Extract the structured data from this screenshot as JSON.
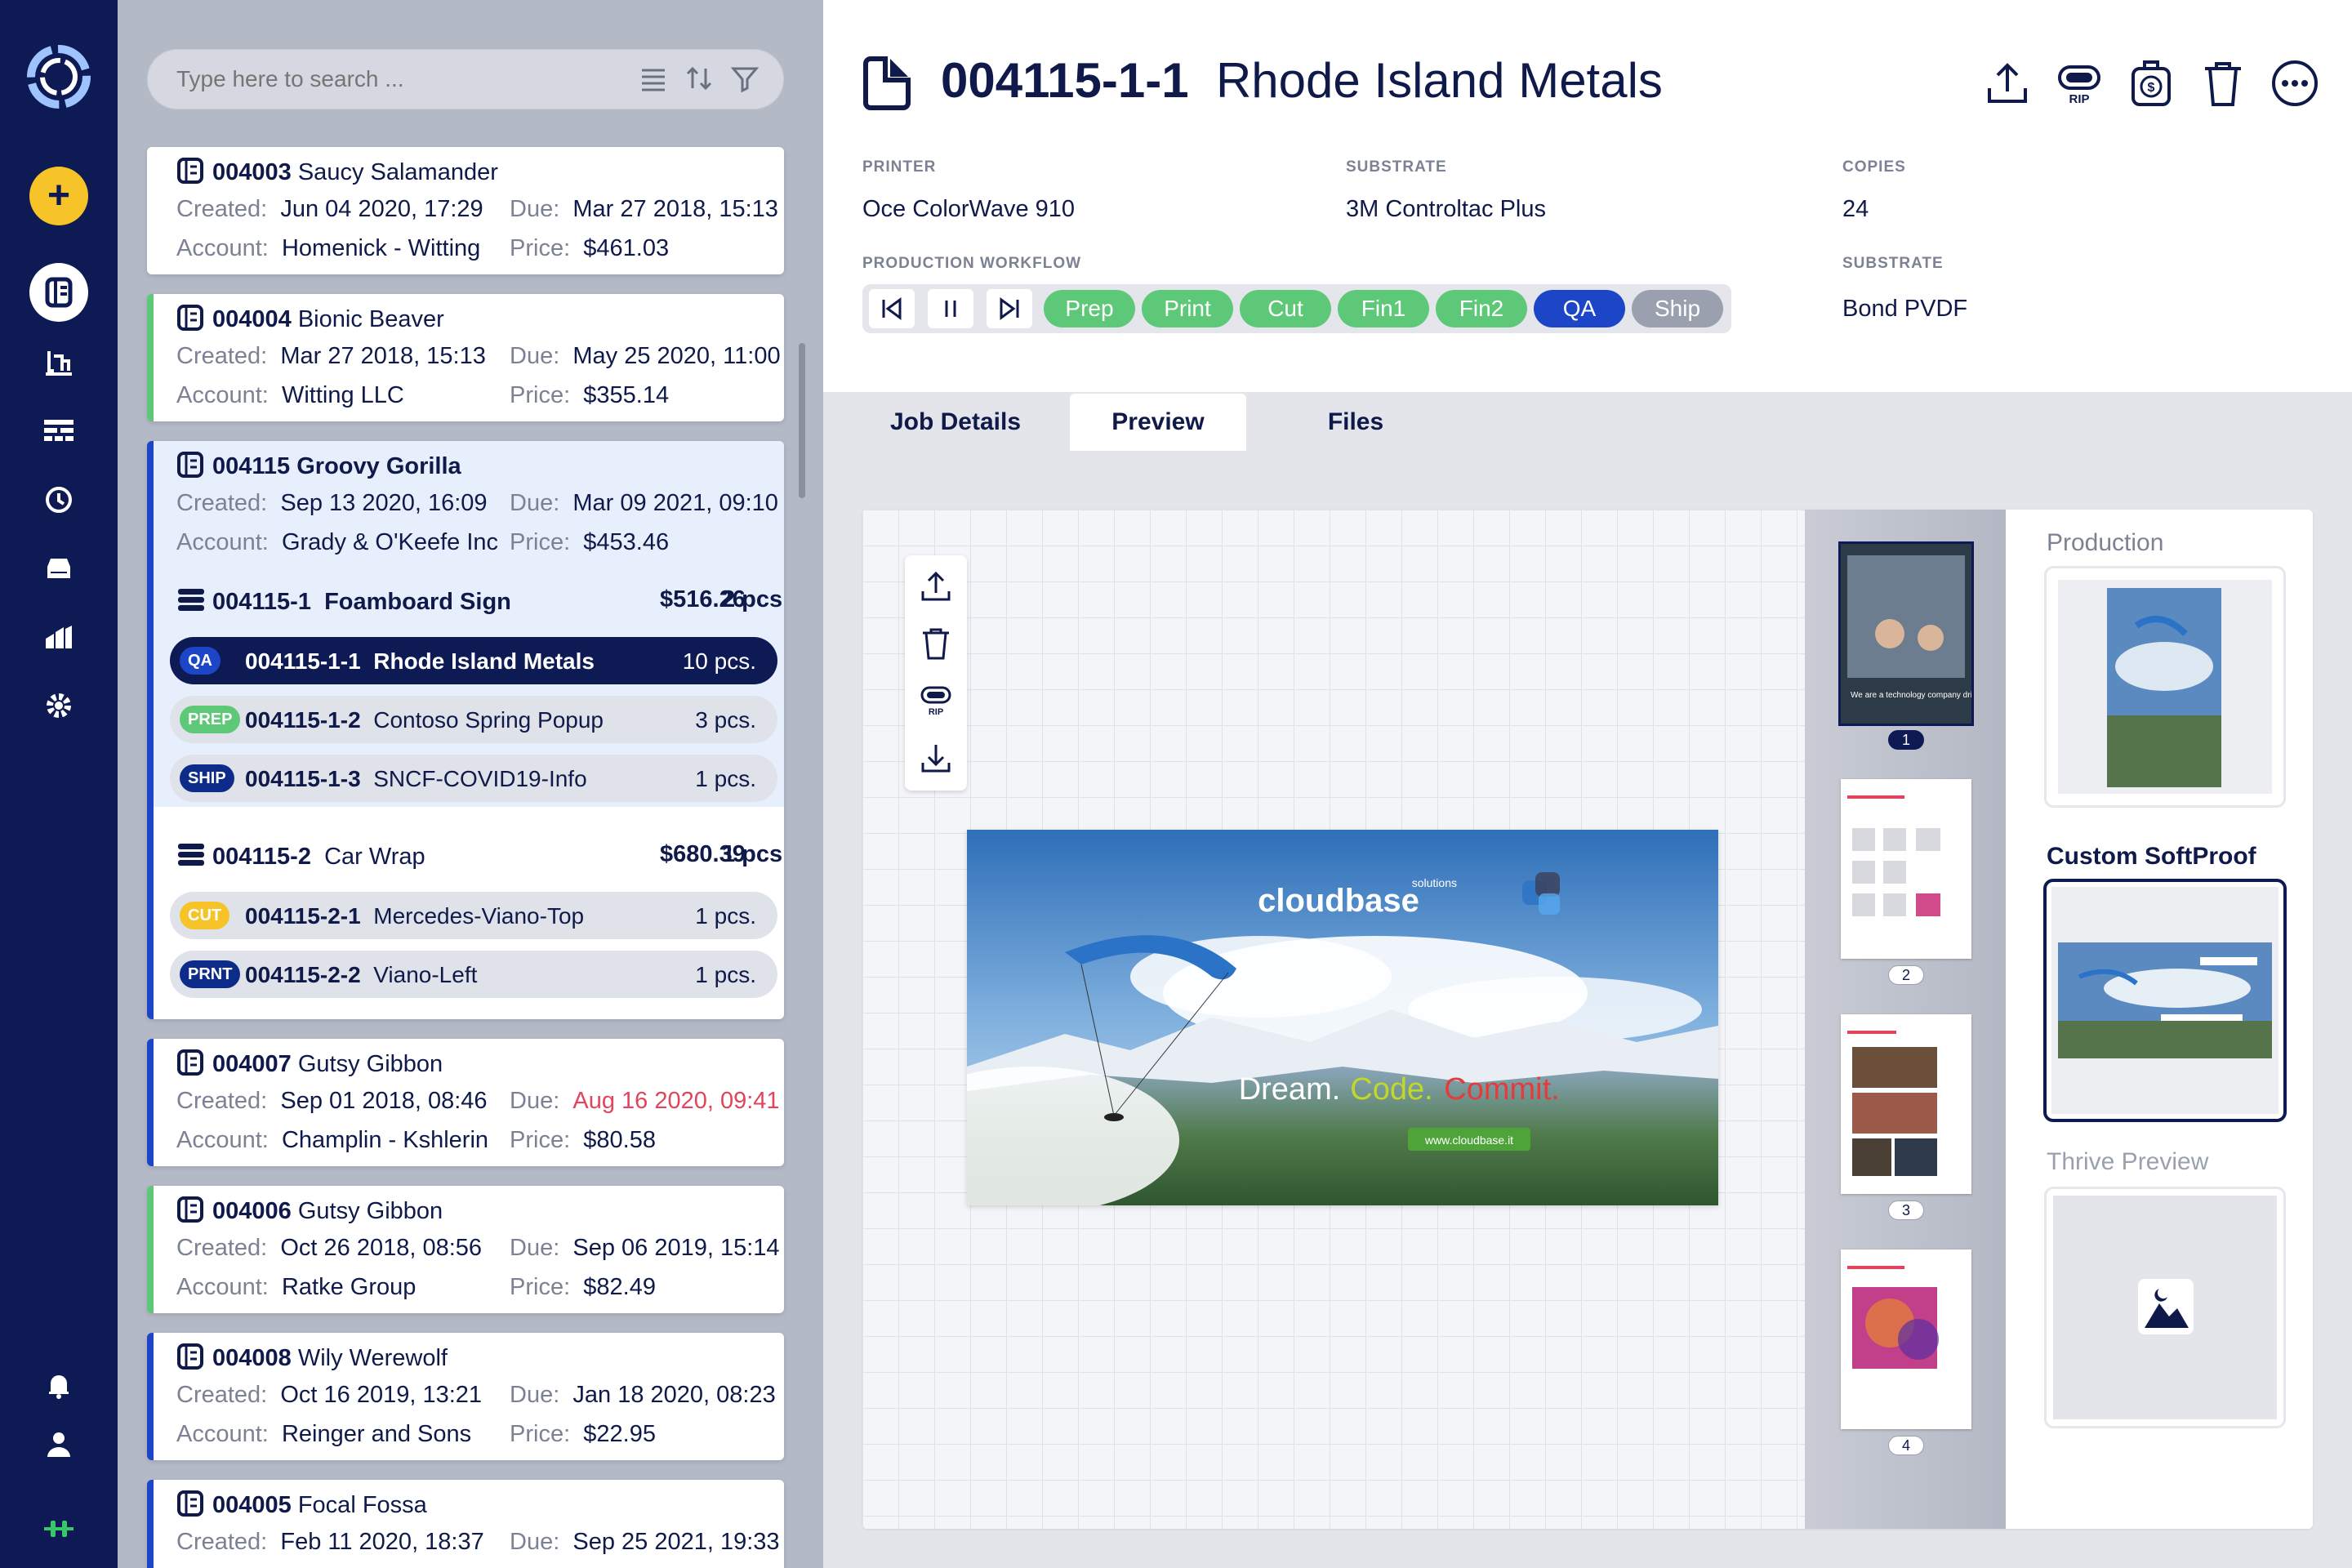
{
  "rail": {
    "items": [
      "sync-logo",
      "add",
      "jobs",
      "printers",
      "dashboard",
      "history",
      "storage",
      "reports",
      "settings",
      "notifications",
      "profile",
      "brand"
    ]
  },
  "search": {
    "placeholder": "Type here to search ..."
  },
  "jobs": [
    {
      "id": "004003",
      "name": "Saucy Salamander",
      "created_label": "Created:",
      "created": "Jun 04 2020, 17:29",
      "due_label": "Due:",
      "due": "Mar 27 2018, 15:13",
      "account_label": "Account:",
      "account": "Homenick - Witting",
      "price_label": "Price:",
      "price": "$461.03"
    },
    {
      "id": "004004",
      "name": "Bionic Beaver",
      "created_label": "Created:",
      "created": "Mar 27 2018, 15:13",
      "due_label": "Due:",
      "due": "May 25 2020, 11:00",
      "account_label": "Account:",
      "account": "Witting LLC",
      "price_label": "Price:",
      "price": "$355.14"
    },
    {
      "id": "004115",
      "name": "Groovy Gorilla",
      "created_label": "Created:",
      "created": "Sep 13 2020, 16:09",
      "due_label": "Due:",
      "due": "Mar 09 2021, 09:10",
      "account_label": "Account:",
      "account": "Grady & O'Keefe Inc",
      "price_label": "Price:",
      "price": "$453.46"
    },
    {
      "id": "004007",
      "name": "Gutsy Gibbon",
      "created_label": "Created:",
      "created": "Sep 01 2018, 08:46",
      "due_label": "Due:",
      "due": "Aug 16 2020, 09:41",
      "account_label": "Account:",
      "account": "Champlin - Kshlerin",
      "price_label": "Price:",
      "price": "$80.58"
    },
    {
      "id": "004006",
      "name": "Gutsy Gibbon",
      "created_label": "Created:",
      "created": "Oct 26 2018, 08:56",
      "due_label": "Due:",
      "due": "Sep 06 2019, 15:14",
      "account_label": "Account:",
      "account": "Ratke Group",
      "price_label": "Price:",
      "price": "$82.49"
    },
    {
      "id": "004008",
      "name": "Wily Werewolf",
      "created_label": "Created:",
      "created": "Oct 16 2019, 13:21",
      "due_label": "Due:",
      "due": "Jan 18 2020, 08:23",
      "account_label": "Account:",
      "account": "Reinger and Sons",
      "price_label": "Price:",
      "price": "$22.95"
    },
    {
      "id": "004005",
      "name": "Focal Fossa",
      "created_label": "Created:",
      "created": "Feb 11 2020, 18:37",
      "due_label": "Due:",
      "due": "Sep 25 2021, 19:33"
    }
  ],
  "subjobs": [
    {
      "id": "004115-1",
      "name": "Foamboard Sign",
      "qty": "2 pcs.",
      "price": "$516.26"
    },
    {
      "id": "004115-2",
      "name": "Car Wrap",
      "qty": "1 pcs.",
      "price": "$680.39"
    }
  ],
  "items": [
    {
      "tag": "QA",
      "id": "004115-1-1",
      "name": "Rhode Island Metals",
      "qty": "10 pcs.",
      "tag_color": "#1c46c7"
    },
    {
      "tag": "PREP",
      "id": "004115-1-2",
      "name": "Contoso Spring Popup",
      "qty": "3 pcs.",
      "tag_color": "#5ec879"
    },
    {
      "tag": "SHIP",
      "id": "004115-1-3",
      "name": "SNCF-COVID19-Info",
      "qty": "1 pcs.",
      "tag_color": "#0d2c8a"
    },
    {
      "tag": "CUT",
      "id": "004115-2-1",
      "name": "Mercedes-Viano-Top",
      "qty": "1 pcs.",
      "tag_color": "#f6c429"
    },
    {
      "tag": "PRNT",
      "id": "004115-2-2",
      "name": "Viano-Left",
      "qty": "1 pcs.",
      "tag_color": "#0d2c8a"
    }
  ],
  "detail": {
    "id": "004115-1-1",
    "title": "Rhode Island Metals",
    "printer_label": "PRINTER",
    "printer": "Oce ColorWave 910",
    "substrate_label": "SUBSTRATE",
    "substrate": "3M Controltac Plus",
    "copies_label": "COPIES",
    "copies": "24",
    "workflow_label": "PRODUCTION WORKFLOW",
    "substrate2_label": "SUBSTRATE",
    "substrate2": "Bond PVDF",
    "toolbar": [
      "upload-icon",
      "rip-icon",
      "price-icon",
      "delete-icon",
      "more-icon"
    ],
    "rip_text": "RIP",
    "workflow": [
      {
        "label": "Prep",
        "color": "#5ec879"
      },
      {
        "label": "Print",
        "color": "#5ec879"
      },
      {
        "label": "Cut",
        "color": "#5ec879"
      },
      {
        "label": "Fin1",
        "color": "#5ec879"
      },
      {
        "label": "Fin2",
        "color": "#5ec879"
      },
      {
        "label": "QA",
        "color": "#1c46c7"
      },
      {
        "label": "Ship",
        "color": "#9aa0ae"
      }
    ]
  },
  "tabs": {
    "job_details": "Job Details",
    "preview": "Preview",
    "files": "Files",
    "active": "Preview"
  },
  "preview": {
    "banner_brand": "cloudbase",
    "banner_brand_sub": "solutions",
    "tagline_1": "Dream.",
    "tagline_2": "Code.",
    "tagline_3": "Commit.",
    "url": "www.cloudbase.it",
    "thumb1_text": "We are a technology company driven by people",
    "pages": [
      "1",
      "2",
      "3",
      "4"
    ],
    "rip_text": "RIP",
    "side_production": "Production",
    "side_custom": "Custom SoftProof",
    "side_thrive": "Thrive Preview"
  },
  "colors": {
    "navy": "#0d1a54",
    "accent": "#1c46c7",
    "green": "#5ec879",
    "yellow": "#f6c429",
    "red": "#e2445c"
  }
}
